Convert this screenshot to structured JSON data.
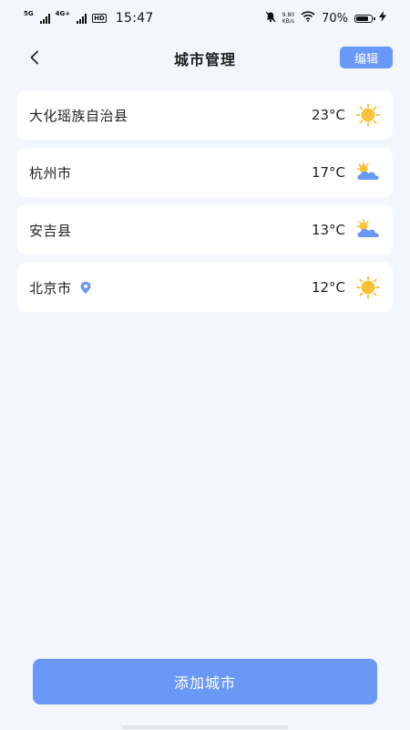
{
  "status_bar": {
    "network_1": "5G",
    "network_2": "4G+",
    "hd_badge": "HD",
    "time": "15:47",
    "speed_value": "9.80",
    "speed_unit": "KB/s",
    "battery": "70%",
    "battery_level": 0.7
  },
  "header": {
    "title": "城市管理",
    "edit_label": "编辑"
  },
  "cities": [
    {
      "name": "大化瑶族自治县",
      "temp": "23°C",
      "weather_icon": "sun-icon",
      "located": false
    },
    {
      "name": "杭州市",
      "temp": "17°C",
      "weather_icon": "partly-cloudy-icon",
      "located": false
    },
    {
      "name": "安吉县",
      "temp": "13°C",
      "weather_icon": "partly-cloudy-icon",
      "located": false
    },
    {
      "name": "北京市",
      "temp": "12°C",
      "weather_icon": "sun-icon",
      "located": true
    }
  ],
  "add_button_label": "添加城市",
  "colors": {
    "accent": "#6a98f7",
    "background": "#f3f7fd",
    "card": "#ffffff",
    "sun": "#f9c23c",
    "cloud": "#6a98f7"
  }
}
